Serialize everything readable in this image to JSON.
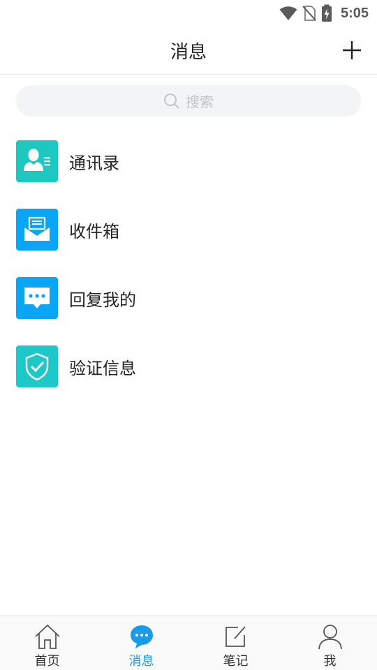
{
  "status_bar": {
    "time": "5:05",
    "icons": [
      "wifi-icon",
      "no-sim-icon",
      "battery-charging-icon"
    ]
  },
  "header": {
    "title": "消息",
    "add_icon": "plus-icon"
  },
  "search": {
    "placeholder": "搜索",
    "icon": "search-icon"
  },
  "menu": {
    "items": [
      {
        "label": "通讯录",
        "icon": "contacts-icon",
        "color": "#1ec8c0"
      },
      {
        "label": "收件箱",
        "icon": "inbox-icon",
        "color": "#0aa5f5"
      },
      {
        "label": "回复我的",
        "icon": "chat-bubble-icon",
        "color": "#0aa5f5"
      },
      {
        "label": "验证信息",
        "icon": "shield-check-icon",
        "color": "#1ec8c8"
      }
    ]
  },
  "tabs": {
    "active_color": "#1a9bea",
    "items": [
      {
        "label": "首页",
        "icon": "home-icon",
        "active": false
      },
      {
        "label": "消息",
        "icon": "message-icon",
        "active": true
      },
      {
        "label": "笔记",
        "icon": "edit-note-icon",
        "active": false
      },
      {
        "label": "我",
        "icon": "person-icon",
        "active": false
      }
    ]
  }
}
